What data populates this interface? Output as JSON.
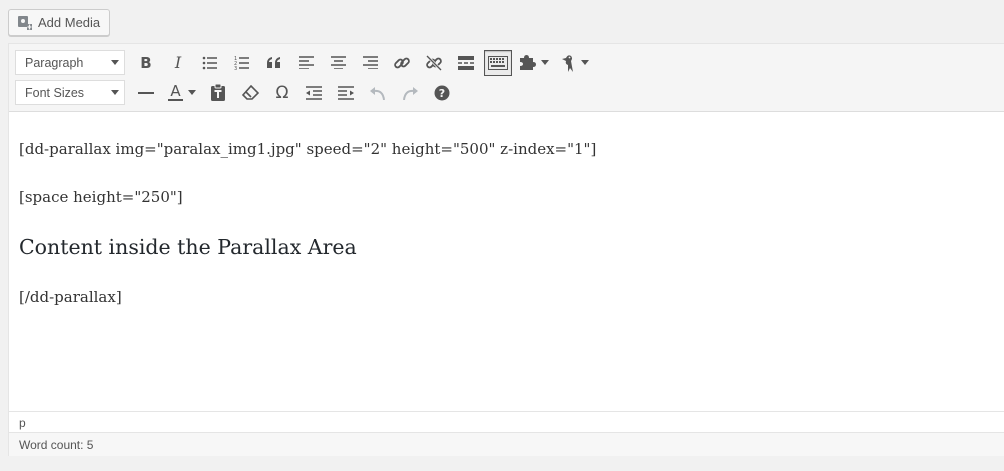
{
  "media": {
    "add_media_label": "Add Media"
  },
  "toolbar": {
    "format_select": "Paragraph",
    "font_size_select": "Font Sizes",
    "bold_glyph": "B",
    "italic_glyph": "I",
    "text_color_glyph": "A",
    "icons_row1": [
      "bold-icon",
      "italic-icon",
      "bulleted-list-icon",
      "numbered-list-icon",
      "blockquote-icon",
      "align-left-icon",
      "align-center-icon",
      "align-right-icon",
      "insert-link-icon",
      "unlink-icon",
      "read-more-icon",
      "toolbar-toggle-icon",
      "plugin-puzzle-icon",
      "woodpecker-icon"
    ],
    "icons_row2": [
      "horizontal-line-icon",
      "text-color-icon",
      "paste-as-text-icon",
      "clear-formatting-icon",
      "special-character-icon",
      "decrease-indent-icon",
      "increase-indent-icon",
      "undo-icon",
      "redo-icon",
      "help-icon"
    ],
    "colors": {
      "active_border": "#555555",
      "disabled": "#aaaaaa"
    }
  },
  "content": {
    "line1": "[dd-parallax img=\"paralax_img1.jpg\" speed=\"2\" height=\"500\" z-index=\"1\"]",
    "line2": "[space height=\"250\"]",
    "heading": "Content inside the Parallax Area",
    "line4": "[/dd-parallax]"
  },
  "status": {
    "path": "p",
    "word_count": "Word count: 5"
  }
}
